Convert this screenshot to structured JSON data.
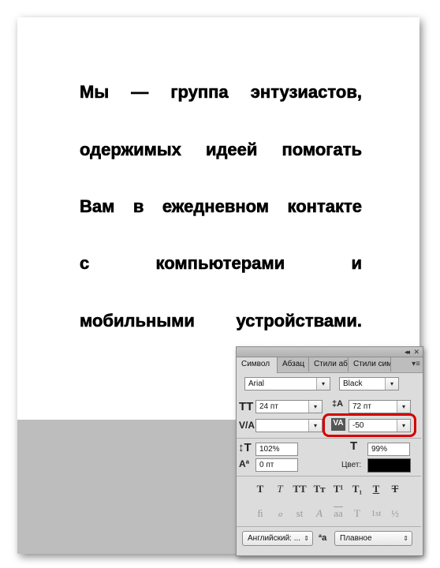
{
  "document": {
    "lines": [
      [
        "Мы",
        "—",
        "группа",
        "энтузиастов,"
      ],
      [
        "одержимых",
        "идеей",
        "помогать"
      ],
      [
        "Вам",
        "в",
        "ежедневном",
        "контакте"
      ],
      [
        "с",
        "компьютерами",
        "и"
      ],
      [
        "мобильными",
        "устройствами."
      ]
    ]
  },
  "panel": {
    "tabs": [
      "Символ",
      "Абзац",
      "Стили аб",
      "Стили сим"
    ],
    "font_family": "Arial",
    "font_style": "Black",
    "font_size": "24 пт",
    "leading": "72 пт",
    "kerning": "",
    "tracking": "-50",
    "vertical_scale": "102%",
    "horizontal_scale": "99%",
    "baseline_shift": "0 пт",
    "color_label": "Цвет:",
    "color_value": "#000000",
    "language": "Английский: ...",
    "antialias": "Плавное",
    "style_buttons": [
      "T",
      "T",
      "TT",
      "Tт",
      "T¹",
      "T₁",
      "T",
      "T"
    ],
    "opentype_buttons": [
      "ﬁ",
      "ℴ",
      "st",
      "A",
      "aa",
      "T",
      "1st",
      "½"
    ],
    "aa_icon": "ªa"
  }
}
